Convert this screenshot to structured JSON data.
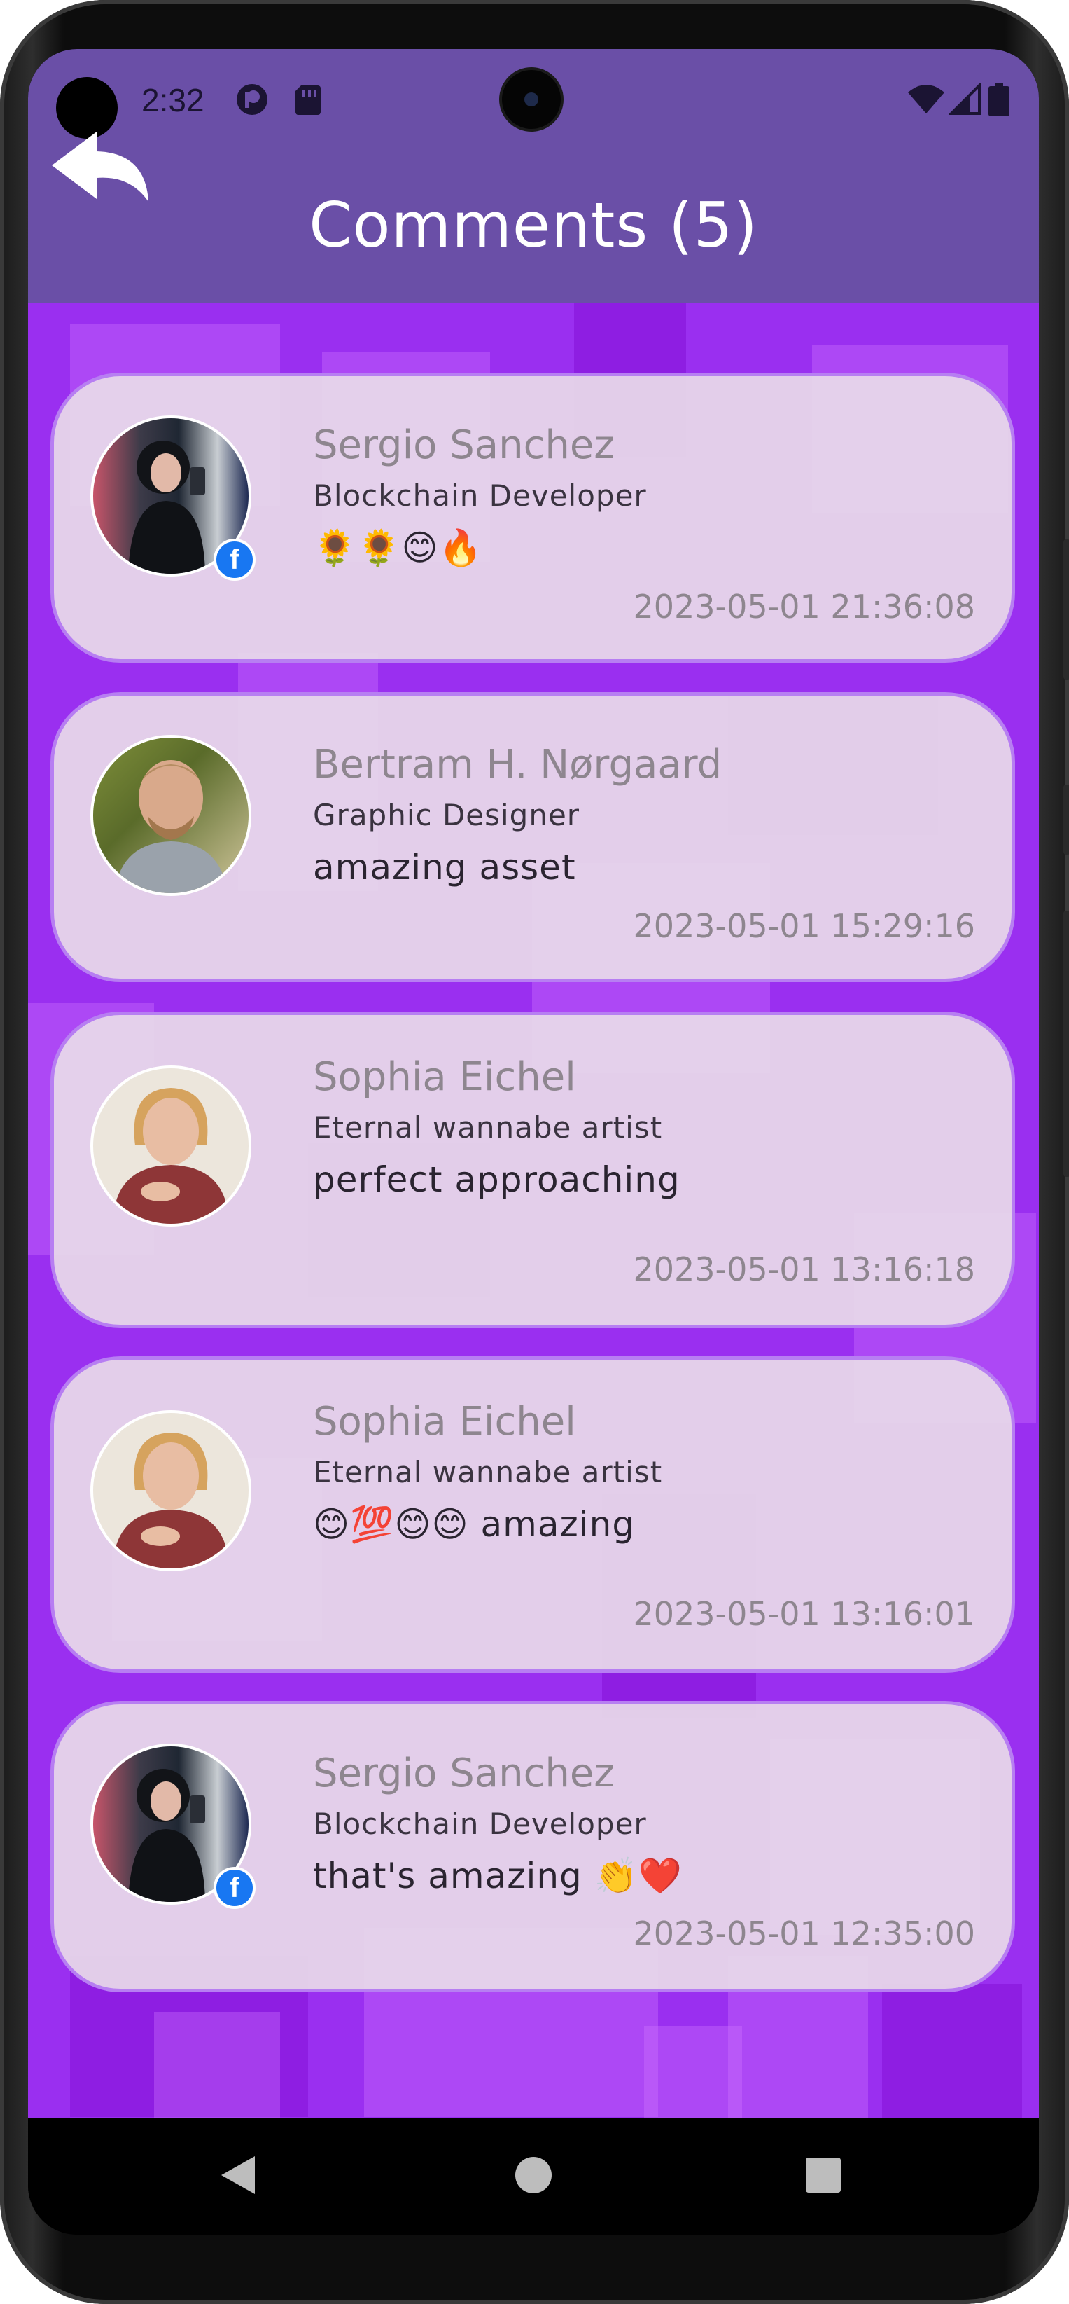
{
  "status_bar": {
    "time": "2:32"
  },
  "app_bar": {
    "title": "Comments (5)"
  },
  "comments": [
    {
      "name": "Sergio Sanchez",
      "role": "Blockchain Developer",
      "message": "🌻🌻😊🔥",
      "timestamp": "2023-05-01 21:36:08",
      "facebook": true
    },
    {
      "name": "Bertram H. Nørgaard",
      "role": "Graphic Designer",
      "message": "amazing asset",
      "timestamp": "2023-05-01 15:29:16",
      "facebook": false
    },
    {
      "name": "Sophia Eichel",
      "role": "Eternal wannabe artist",
      "message": "perfect approaching",
      "timestamp": "2023-05-01 13:16:18",
      "facebook": false
    },
    {
      "name": "Sophia Eichel",
      "role": "Eternal wannabe artist",
      "message": "😊💯😊😊 amazing",
      "timestamp": "2023-05-01 13:16:01",
      "facebook": false
    },
    {
      "name": "Sergio Sanchez",
      "role": "Blockchain Developer",
      "message": "that's amazing 👏❤️",
      "timestamp": "2023-05-01 12:35:00",
      "facebook": true
    }
  ],
  "colors": {
    "app_bar": "#6a4fa7",
    "background": "#9a2ff0",
    "card": "#e8daea",
    "card_border": "#b77ef2",
    "facebook_badge": "#1877f2"
  },
  "icons": {
    "back": "back-arrow-icon",
    "facebook": "facebook-icon",
    "nav_back": "triangle-back-icon",
    "nav_home": "circle-home-icon",
    "nav_recents": "square-recents-icon"
  }
}
